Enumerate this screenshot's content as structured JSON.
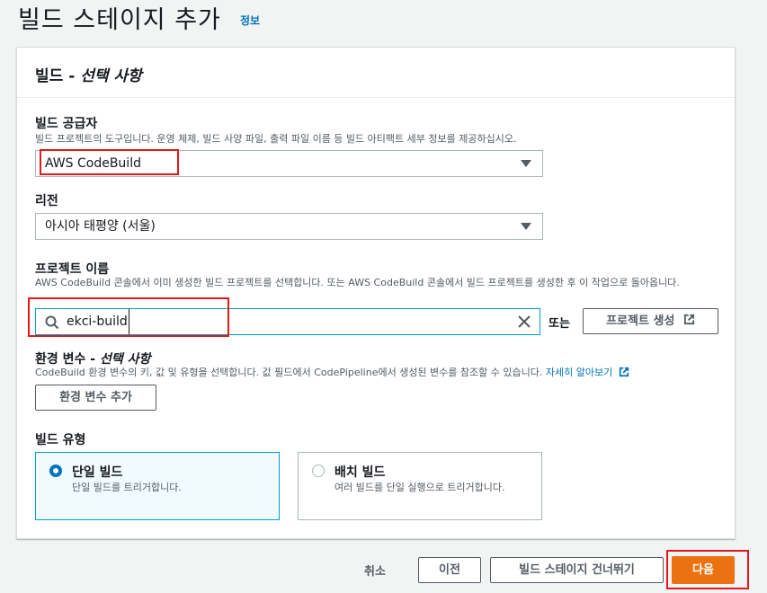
{
  "header": {
    "title": "빌드 스테이지 추가",
    "info": "정보"
  },
  "card": {
    "title_prefix": "빌드 - ",
    "title_optional": "선택 사항"
  },
  "provider": {
    "label": "빌드 공급자",
    "description": "빌드 프로젝트의 도구입니다. 운영 체제, 빌드 사양 파일, 출력 파일 이름 등 빌드 아티팩트 세부 정보를 제공하십시오.",
    "value": "AWS CodeBuild"
  },
  "region": {
    "label": "리전",
    "value": "아시아 태평양 (서울)"
  },
  "project": {
    "label": "프로젝트 이름",
    "description": "AWS CodeBuild 콘솔에서 이미 생성한 빌드 프로젝트를 선택합니다. 또는 AWS CodeBuild 콘솔에서 빌드 프로젝트를 생성한 후 이 작업으로 돌아옵니다.",
    "value": "ekci-build",
    "or": "또는",
    "create_button": "프로젝트 생성"
  },
  "env": {
    "label": "환경 변수 - ",
    "label_optional": "선택 사항",
    "description": "CodeBuild 환경 변수의 키, 값 및 유형을 선택합니다. 값 필드에서 CodePipeline에서 생성된 변수를 참조할 수 있습니다.",
    "learn_more": "자세히 알아보기",
    "add_button": "환경 변수 추가"
  },
  "build_type": {
    "label": "빌드 유형",
    "options": [
      {
        "title": "단일 빌드",
        "description": "단일 빌드를 트리거합니다.",
        "selected": true
      },
      {
        "title": "배치 빌드",
        "description": "여러 빌드를 단일 실행으로 트리거합니다.",
        "selected": false
      }
    ]
  },
  "footer": {
    "cancel": "취소",
    "previous": "이전",
    "skip": "빌드 스테이지 건너뛰기",
    "next": "다음"
  },
  "colors": {
    "primary": "#ec7211",
    "link": "#0073bb",
    "focus": "#00a1c9",
    "annotation": "#e0191c"
  }
}
